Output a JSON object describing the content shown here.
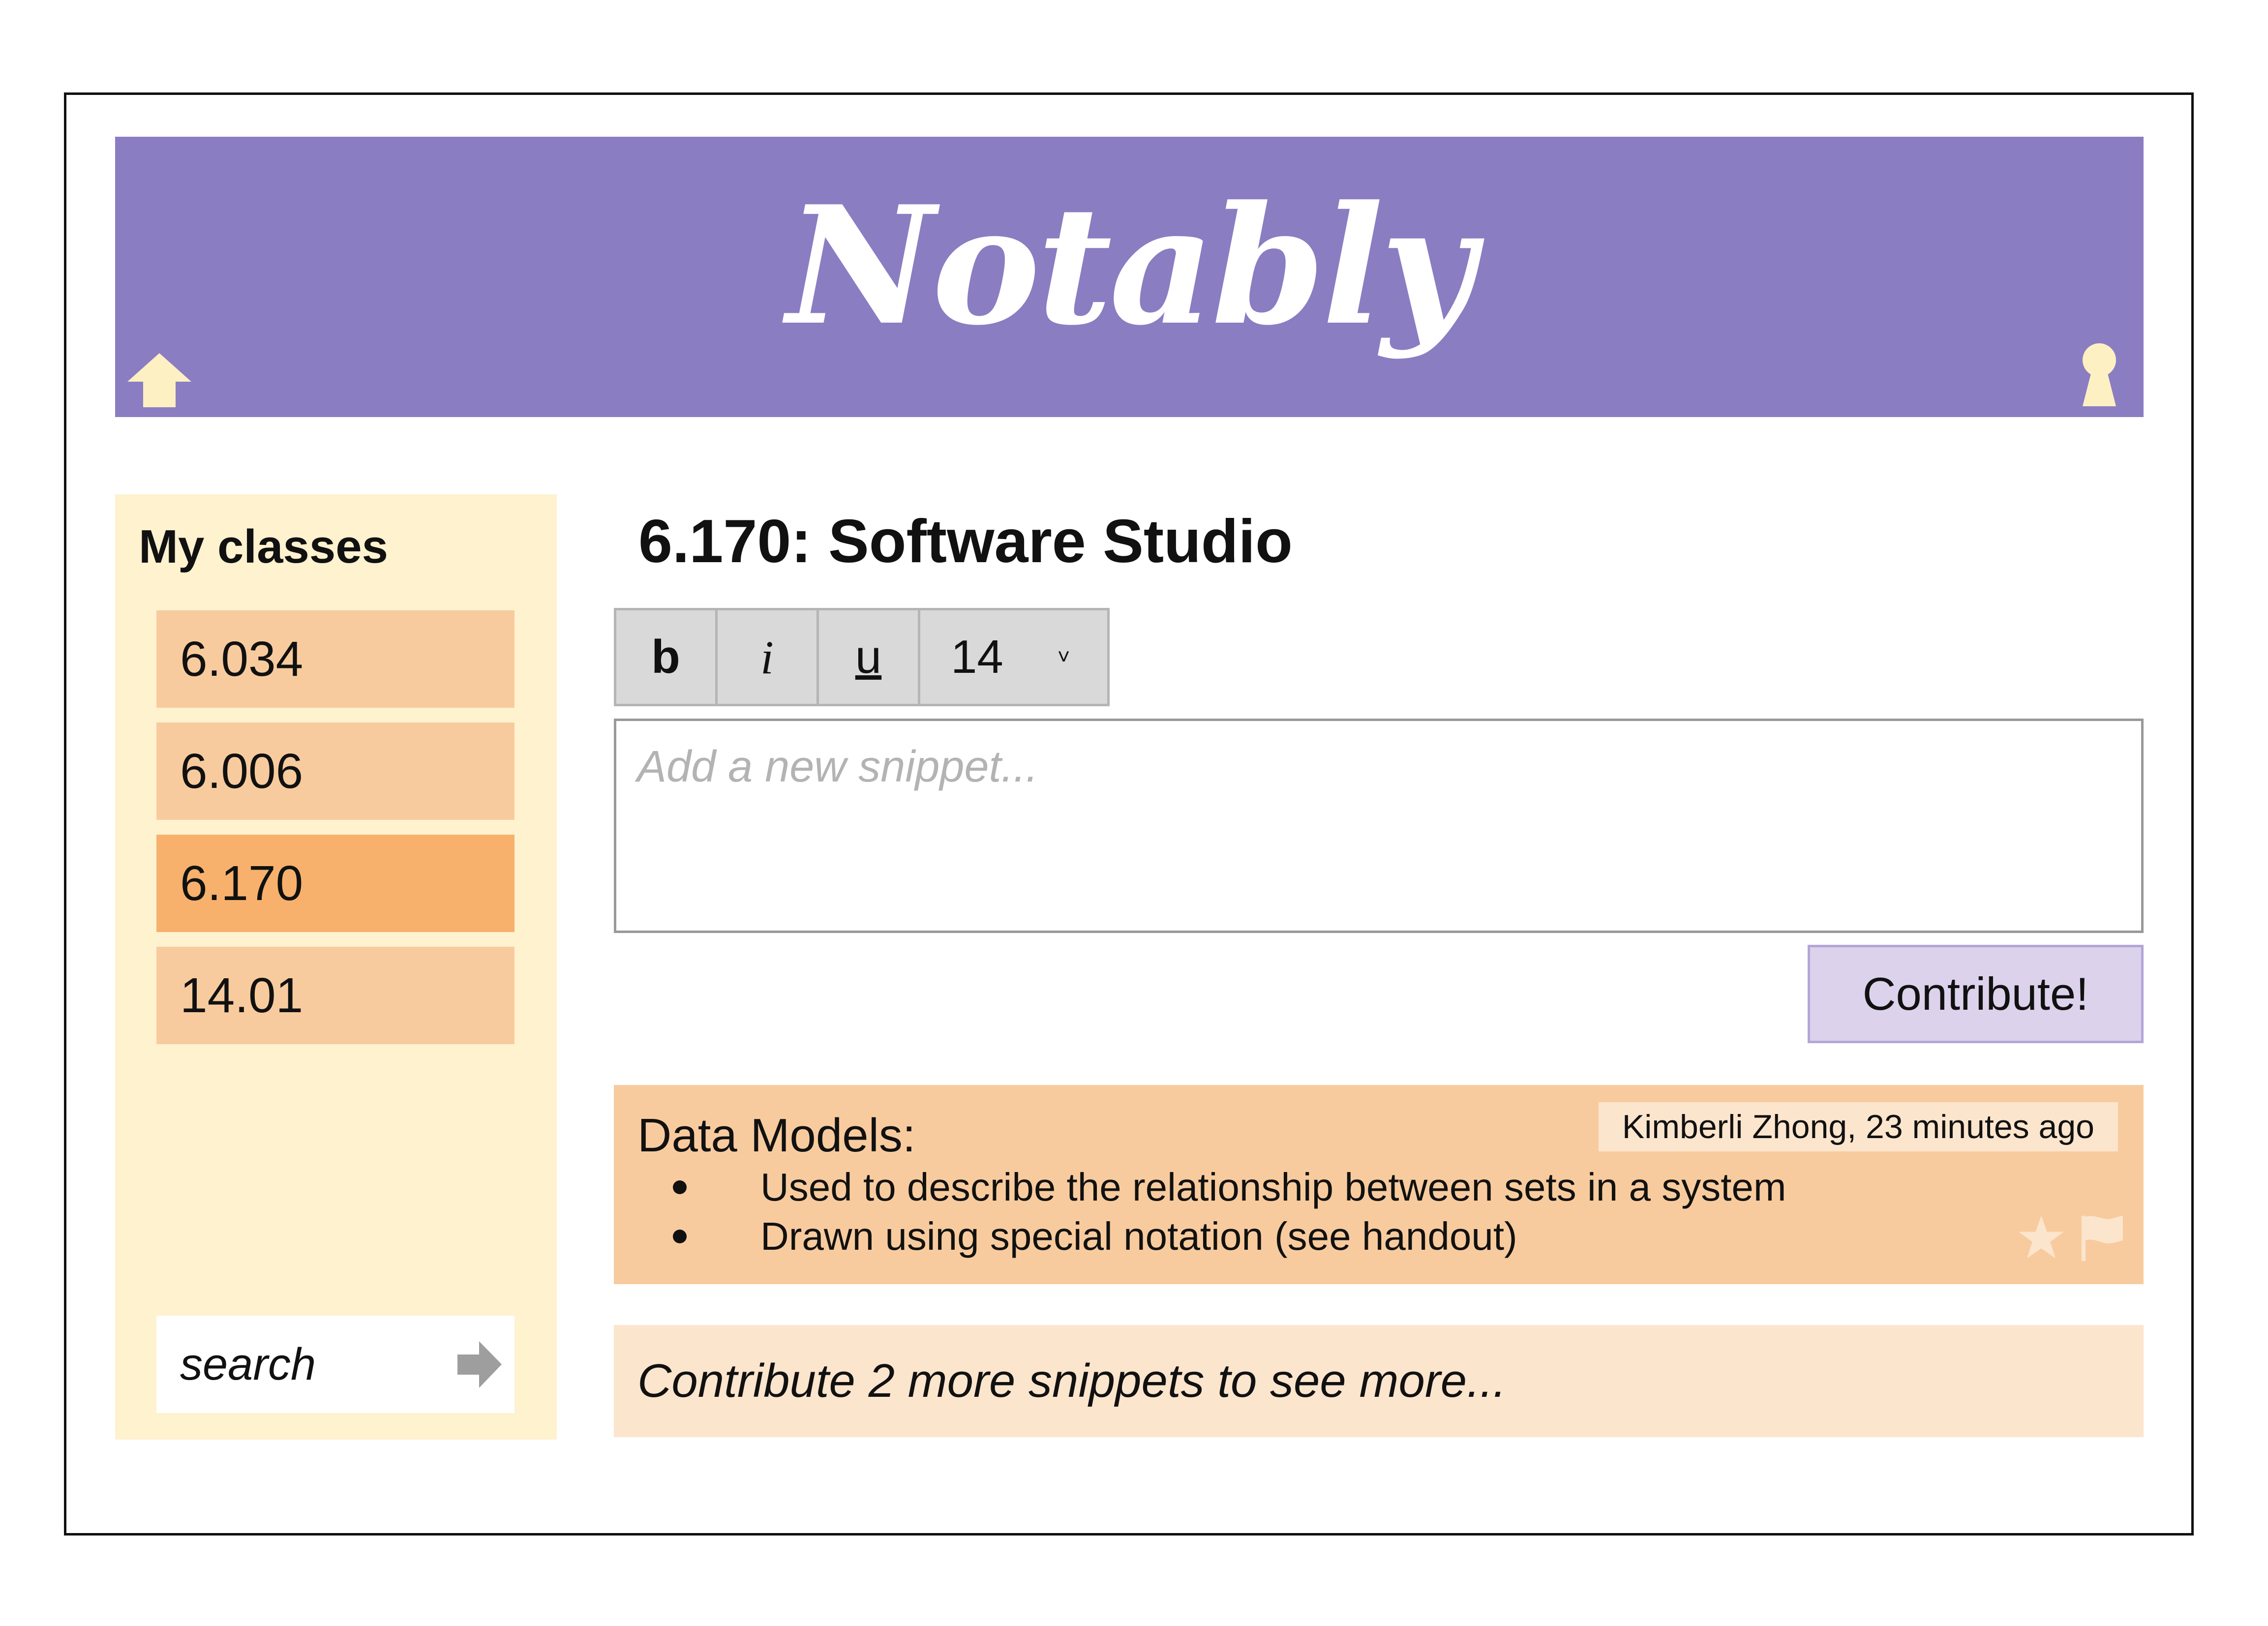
{
  "app": {
    "logo_text": "Notably",
    "header_color": "#8b7dc2",
    "header_icons": [
      "home-icon",
      "keyhole-icon"
    ],
    "icon_color": "#fdf0c3"
  },
  "sidebar": {
    "title": "My classes",
    "items": [
      {
        "label": "6.034",
        "active": false
      },
      {
        "label": "6.006",
        "active": false
      },
      {
        "label": "6.170",
        "active": true
      },
      {
        "label": "14.01",
        "active": false
      }
    ],
    "search": {
      "placeholder": "search",
      "submit_icon": "arrow-right-icon"
    }
  },
  "main": {
    "class_title": "6.170: Software Studio",
    "toolbar": {
      "bold_label": "b",
      "italic_label": "i",
      "underline_label": "u",
      "font_size": "14",
      "dropdown_icon": "chevron-down-icon"
    },
    "snippet_input": {
      "placeholder": "Add a new snippet..."
    },
    "contribute_label": "Contribute!",
    "snippets": [
      {
        "title": "Data Models:",
        "meta": "Kimberli Zhong, 23 minutes ago",
        "bullets": [
          "Used to describe the relationship between sets in a system",
          "Drawn using special notation (see handout)"
        ],
        "actions": [
          "star-icon",
          "flag-icon"
        ]
      }
    ],
    "locked_message": "Contribute 2 more snippets to see more..."
  }
}
